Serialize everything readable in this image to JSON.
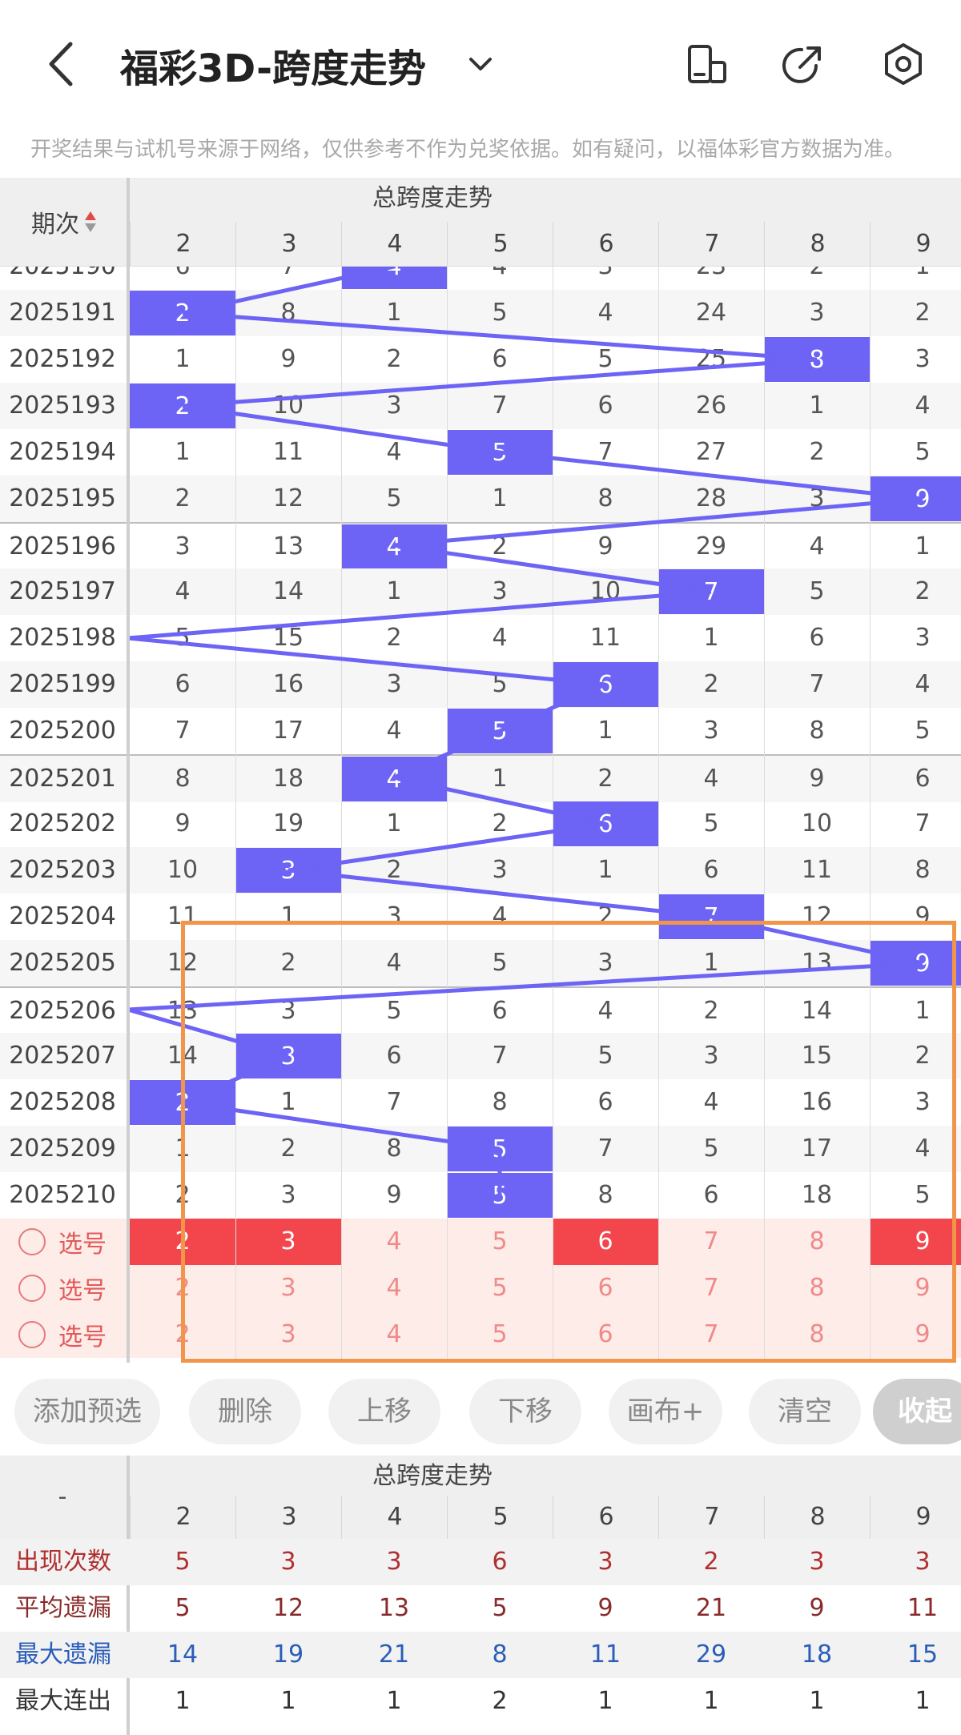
{
  "header": {
    "title": "福彩3D-跨度走势",
    "notice": "开奖结果与试机号来源于网络，仅供参考不作为兑奖依据。如有疑问，以福体彩官方数据为准。"
  },
  "trend": {
    "period_header": "期次",
    "group_title": "总跨度走势",
    "columns": [
      "2",
      "3",
      "4",
      "5",
      "6",
      "7",
      "8",
      "9"
    ],
    "rows": [
      {
        "period": "2025190",
        "values": [
          "6",
          "7",
          "4",
          "4",
          "3",
          "23",
          "2",
          "1"
        ],
        "hit": 2
      },
      {
        "period": "2025191",
        "values": [
          "2",
          "8",
          "1",
          "5",
          "4",
          "24",
          "3",
          "2"
        ],
        "hit": 0
      },
      {
        "period": "2025192",
        "values": [
          "1",
          "9",
          "2",
          "6",
          "5",
          "25",
          "8",
          "3"
        ],
        "hit": 6
      },
      {
        "period": "2025193",
        "values": [
          "2",
          "10",
          "3",
          "7",
          "6",
          "26",
          "1",
          "4"
        ],
        "hit": 0
      },
      {
        "period": "2025194",
        "values": [
          "1",
          "11",
          "4",
          "5",
          "7",
          "27",
          "2",
          "5"
        ],
        "hit": 3
      },
      {
        "period": "2025195",
        "values": [
          "2",
          "12",
          "5",
          "1",
          "8",
          "28",
          "3",
          "9"
        ],
        "hit": 7
      },
      {
        "period": "2025196",
        "values": [
          "3",
          "13",
          "4",
          "2",
          "9",
          "29",
          "4",
          "1"
        ],
        "hit": 2
      },
      {
        "period": "2025197",
        "values": [
          "4",
          "14",
          "1",
          "3",
          "10",
          "7",
          "5",
          "2"
        ],
        "hit": 5
      },
      {
        "period": "2025198",
        "values": [
          "5",
          "15",
          "2",
          "4",
          "11",
          "1",
          "6",
          "3"
        ],
        "hit": -1
      },
      {
        "period": "2025199",
        "values": [
          "6",
          "16",
          "3",
          "5",
          "6",
          "2",
          "7",
          "4"
        ],
        "hit": 4
      },
      {
        "period": "2025200",
        "values": [
          "7",
          "17",
          "4",
          "5",
          "1",
          "3",
          "8",
          "5"
        ],
        "hit": 3
      },
      {
        "period": "2025201",
        "values": [
          "8",
          "18",
          "4",
          "1",
          "2",
          "4",
          "9",
          "6"
        ],
        "hit": 2
      },
      {
        "period": "2025202",
        "values": [
          "9",
          "19",
          "1",
          "2",
          "6",
          "5",
          "10",
          "7"
        ],
        "hit": 4
      },
      {
        "period": "2025203",
        "values": [
          "10",
          "3",
          "2",
          "3",
          "1",
          "6",
          "11",
          "8"
        ],
        "hit": 1
      },
      {
        "period": "2025204",
        "values": [
          "11",
          "1",
          "3",
          "4",
          "2",
          "7",
          "12",
          "9"
        ],
        "hit": 5
      },
      {
        "period": "2025205",
        "values": [
          "12",
          "2",
          "4",
          "5",
          "3",
          "1",
          "13",
          "9"
        ],
        "hit": 7
      },
      {
        "period": "2025206",
        "values": [
          "13",
          "3",
          "5",
          "6",
          "4",
          "2",
          "14",
          "1"
        ],
        "hit": -1
      },
      {
        "period": "2025207",
        "values": [
          "14",
          "3",
          "6",
          "7",
          "5",
          "3",
          "15",
          "2"
        ],
        "hit": 1
      },
      {
        "period": "2025208",
        "values": [
          "2",
          "1",
          "7",
          "8",
          "6",
          "4",
          "16",
          "3"
        ],
        "hit": 0
      },
      {
        "period": "2025209",
        "values": [
          "1",
          "2",
          "8",
          "5",
          "7",
          "5",
          "17",
          "4"
        ],
        "hit": 3
      },
      {
        "period": "2025210",
        "values": [
          "2",
          "3",
          "9",
          "5",
          "8",
          "6",
          "18",
          "5"
        ],
        "hit": 3
      }
    ],
    "select_rows": [
      {
        "label": "选号",
        "values": [
          "2",
          "3",
          "4",
          "5",
          "6",
          "7",
          "8",
          "9"
        ],
        "on": [
          0,
          1,
          4,
          7
        ]
      },
      {
        "label": "选号",
        "values": [
          "2",
          "3",
          "4",
          "5",
          "6",
          "7",
          "8",
          "9"
        ],
        "on": []
      },
      {
        "label": "选号",
        "values": [
          "2",
          "3",
          "4",
          "5",
          "6",
          "7",
          "8",
          "9"
        ],
        "on": []
      }
    ]
  },
  "toolbar": {
    "buttons": [
      "添加预选",
      "删除",
      "上移",
      "下移",
      "画布+",
      "清空"
    ],
    "collapse": "收起"
  },
  "stats": {
    "dash": "-",
    "group_title": "总跨度走势",
    "columns": [
      "2",
      "3",
      "4",
      "5",
      "6",
      "7",
      "8",
      "9"
    ],
    "rows": [
      {
        "label": "出现次数",
        "values": [
          "5",
          "3",
          "3",
          "6",
          "3",
          "2",
          "3",
          "3"
        ],
        "color": "#b03030"
      },
      {
        "label": "平均遗漏",
        "values": [
          "5",
          "12",
          "13",
          "5",
          "9",
          "21",
          "9",
          "11"
        ],
        "color": "#8a2b2b"
      },
      {
        "label": "最大遗漏",
        "values": [
          "14",
          "19",
          "21",
          "8",
          "11",
          "29",
          "18",
          "15"
        ],
        "color": "#2a5db8"
      },
      {
        "label": "最大连出",
        "values": [
          "1",
          "1",
          "1",
          "2",
          "1",
          "1",
          "1",
          "1"
        ],
        "color": "#333333"
      }
    ]
  },
  "colors": {
    "hit": "#6d63f5",
    "selected": "#f2464c",
    "highlight_box": "#f0954a"
  }
}
